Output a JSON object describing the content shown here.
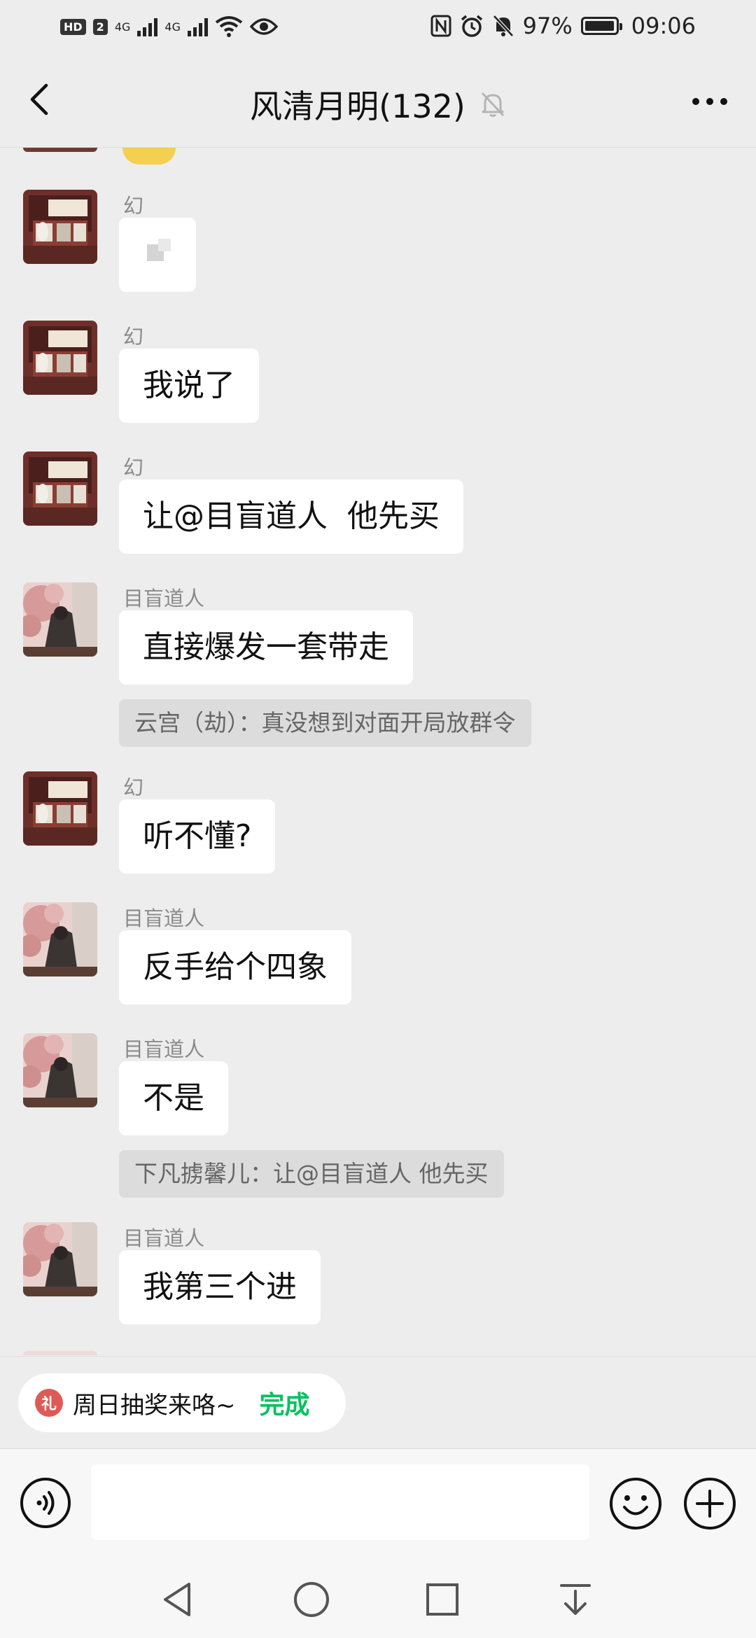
{
  "status_bar": {
    "hd": "HD",
    "sim": "2",
    "net1": "4G",
    "net2": "4G",
    "battery": "97%",
    "battery_level": 0.97,
    "time": "09:06"
  },
  "header": {
    "title": "风清月明(132)"
  },
  "messages": [
    {
      "sender": "幻",
      "text": ""
    },
    {
      "sender": "幻",
      "text": "我说了"
    },
    {
      "sender": "幻",
      "text": "让@目盲道人  他先买"
    },
    {
      "sender": "目盲道人",
      "text": "直接爆发一套带走"
    },
    {
      "sender": "幻",
      "text": "听不懂?"
    },
    {
      "sender": "目盲道人",
      "text": "反手给个四象"
    },
    {
      "sender": "目盲道人",
      "text": "不是"
    },
    {
      "sender": "目盲道人",
      "text": "我第三个进"
    }
  ],
  "quotes": [
    {
      "text": "云宫（劫）：真没想到对面开局放群令"
    },
    {
      "text": "下凡掳馨儿：让@目盲道人 他先买"
    }
  ],
  "prompt": {
    "gift_glyph": "礼",
    "text": "周日抽奖来咯~",
    "done": "完成"
  },
  "input": {
    "value": "",
    "placeholder": ""
  },
  "icons": {
    "back": "back-arrow-icon",
    "mute": "muted-bell-icon",
    "more": "more-dots-icon",
    "voice": "voice-icon",
    "emoji": "emoji-icon",
    "plus": "plus-icon",
    "nav_back": "nav-back-icon",
    "nav_home": "nav-home-icon",
    "nav_recent": "nav-recent-icon",
    "nav_notify": "nav-notification-icon"
  },
  "colors": {
    "accent": "#07c160",
    "background": "#ededed",
    "bubble": "#ffffff",
    "quote_bg": "#dcdcdc"
  }
}
